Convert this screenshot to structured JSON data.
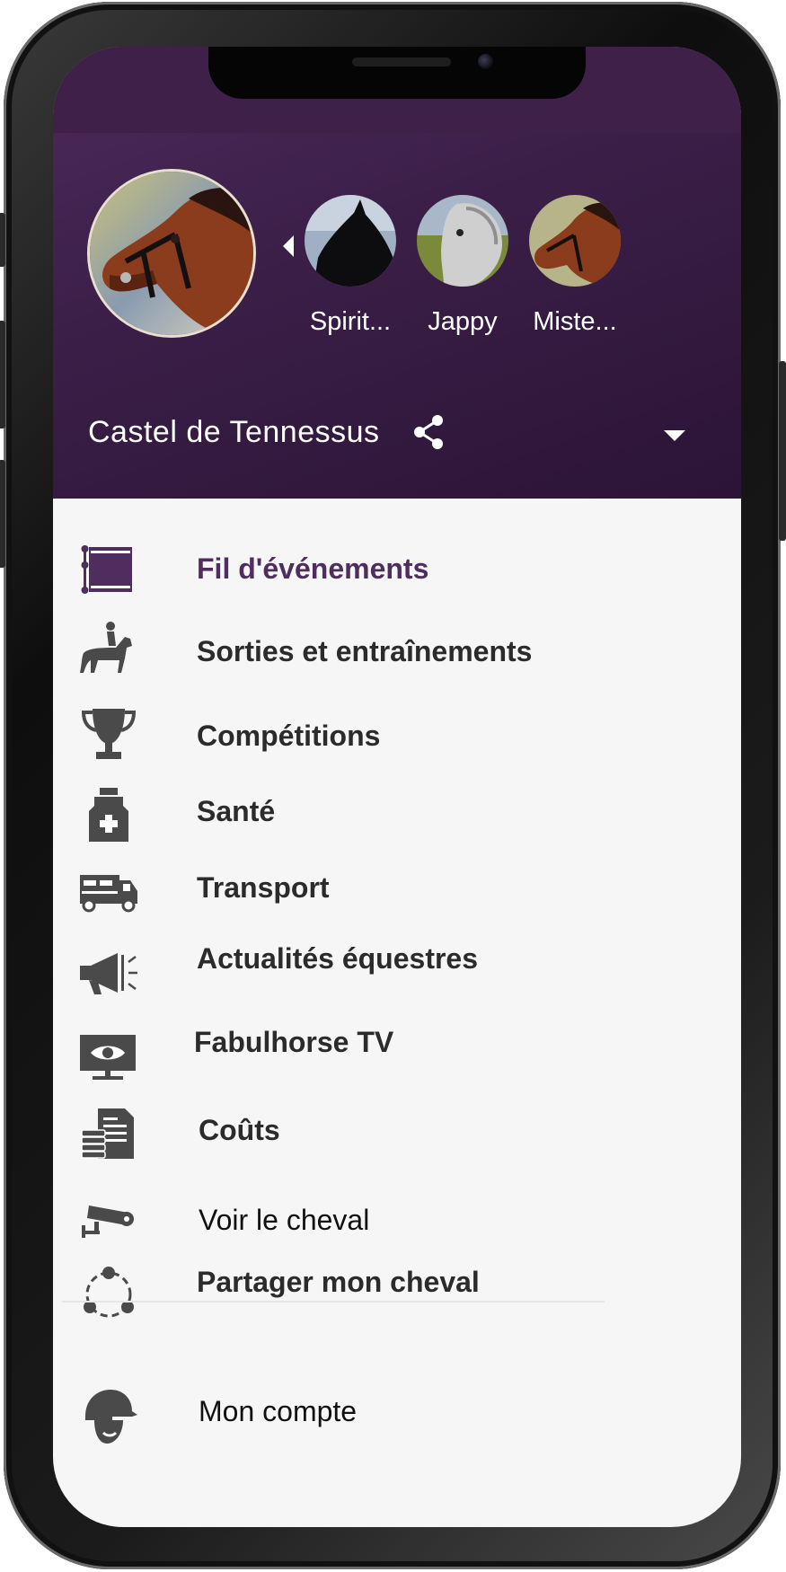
{
  "header": {
    "stable_name": "Castel de Tennessus",
    "horses": [
      {
        "name": "Spirit..."
      },
      {
        "name": "Jappy"
      },
      {
        "name": "Miste..."
      }
    ]
  },
  "menu": {
    "items": [
      {
        "label": "Fil d'événements",
        "icon": "event-feed-icon",
        "active": true
      },
      {
        "label": "Sorties et entraînements",
        "icon": "rider-horse-icon"
      },
      {
        "label": "Compétitions",
        "icon": "trophy-icon"
      },
      {
        "label": "Santé",
        "icon": "medicine-bottle-icon"
      },
      {
        "label": "Transport",
        "icon": "horse-truck-icon"
      },
      {
        "label": "Actualités équestres",
        "icon": "megaphone-icon"
      },
      {
        "label": "Fabulhorse TV",
        "icon": "tv-eye-icon"
      },
      {
        "label": "Coûts",
        "icon": "invoice-stack-icon"
      },
      {
        "label": "Voir le cheval",
        "icon": "security-camera-icon"
      },
      {
        "label": "Partager mon cheval",
        "icon": "share-circle-icon"
      }
    ],
    "account": {
      "label": "Mon compte",
      "icon": "rider-helmet-icon"
    }
  },
  "colors": {
    "header_bg": "#3a1e47",
    "active_text": "#4f2d5e",
    "icon_gray": "#4a4a4a"
  }
}
